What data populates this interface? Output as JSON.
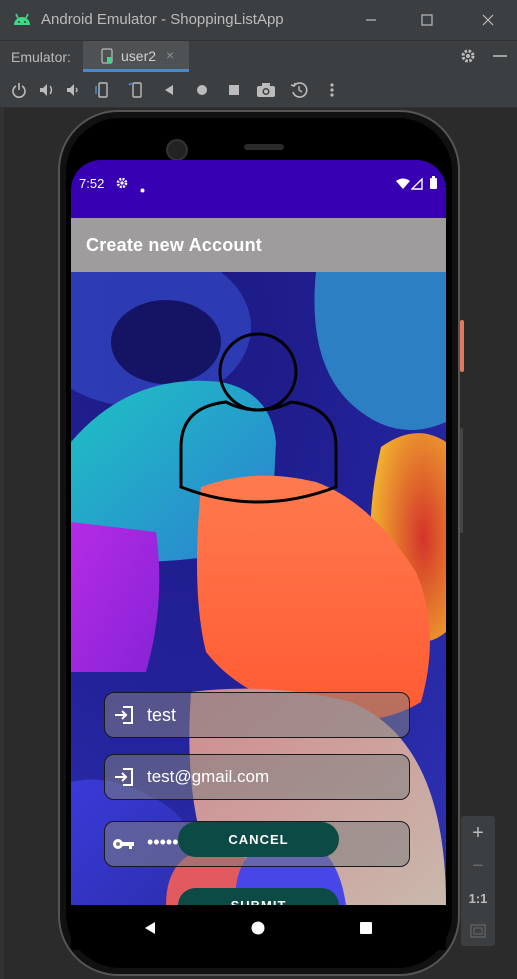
{
  "window": {
    "title": "Android Emulator - ShoppingListApp",
    "controls": [
      "minimize-icon",
      "maximize-icon",
      "close-icon"
    ]
  },
  "tabbar": {
    "label": "Emulator:",
    "tab_name": "user2",
    "tab_close": "×"
  },
  "toolbar": {
    "icons": [
      "power-icon",
      "volume-up-icon",
      "volume-down-icon",
      "rotate-left-icon",
      "rotate-right-icon",
      "back-icon",
      "home-icon",
      "overview-icon",
      "camera-icon",
      "snapshot-icon",
      "more-icon"
    ]
  },
  "device": {
    "status": {
      "time": "7:52",
      "icons": [
        "settings-icon",
        "dot-icon",
        "wifi-icon",
        "signal-icon",
        "battery-icon"
      ]
    },
    "app_bar": {
      "title": "Create new Account"
    },
    "form": {
      "username": {
        "value": "test",
        "icon": "login-icon"
      },
      "email": {
        "value": "test@gmail.com",
        "icon": "login-icon"
      },
      "password": {
        "value": "•••••••••",
        "icon": "key-icon"
      }
    },
    "buttons": {
      "submit": "SUBMIT",
      "cancel": "CANCEL"
    }
  },
  "emulator_panel": {
    "zoom_in": "+",
    "zoom_out": "−",
    "actual_size": "1:1"
  },
  "colors": {
    "status_bar": "#3700b3",
    "app_bar": "#9e9c9c",
    "button": "#0c4a45",
    "ide_background": "#3c3f41"
  }
}
